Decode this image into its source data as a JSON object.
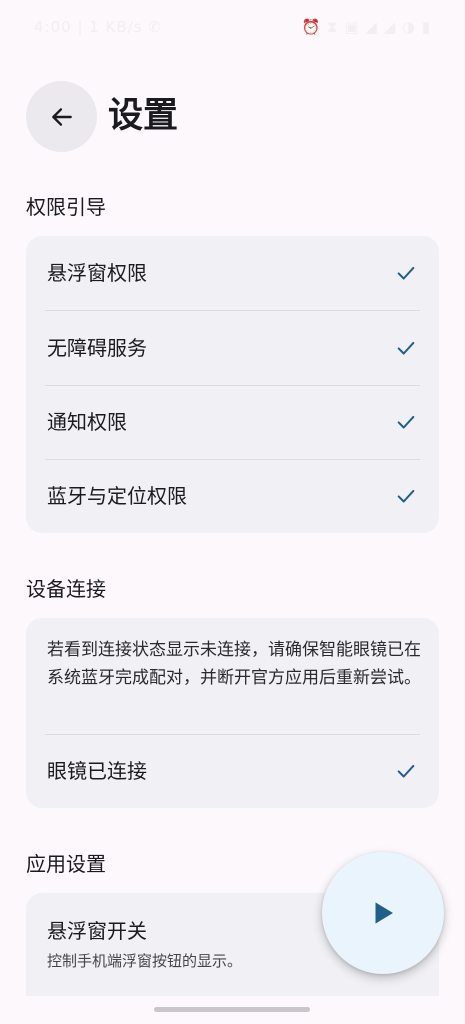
{
  "status_bar": {
    "left_text": "4:00 | 1 KB/s ✆",
    "right_text": "⏰ ⧗ ▣ ◢ ◢ ◑ ▮"
  },
  "header": {
    "title": "设置"
  },
  "sections": {
    "permissions": {
      "title": "权限引导",
      "items": [
        {
          "label": "悬浮窗权限",
          "status_icon": "check-icon"
        },
        {
          "label": "无障碍服务",
          "status_icon": "check-icon"
        },
        {
          "label": "通知权限",
          "status_icon": "check-icon"
        },
        {
          "label": "蓝牙与定位权限",
          "status_icon": "check-icon"
        }
      ]
    },
    "device": {
      "title": "设备连接",
      "info": "若看到连接状态显示未连接，请确保智能眼镜已在系统蓝牙完成配对，并断开官方应用后重新尝试。",
      "status_label": "眼镜已连接",
      "status_icon": "check-icon"
    },
    "app": {
      "title": "应用设置",
      "toggle_label": "悬浮窗开关",
      "toggle_desc": "控制手机端浮窗按钮的显示。"
    }
  },
  "fab": {
    "icon": "play-icon"
  },
  "colors": {
    "background": "#fcf8fc",
    "card": "#f1f0f5",
    "accent": "#1f5f8b",
    "fab_bg": "#eaf4fd"
  }
}
